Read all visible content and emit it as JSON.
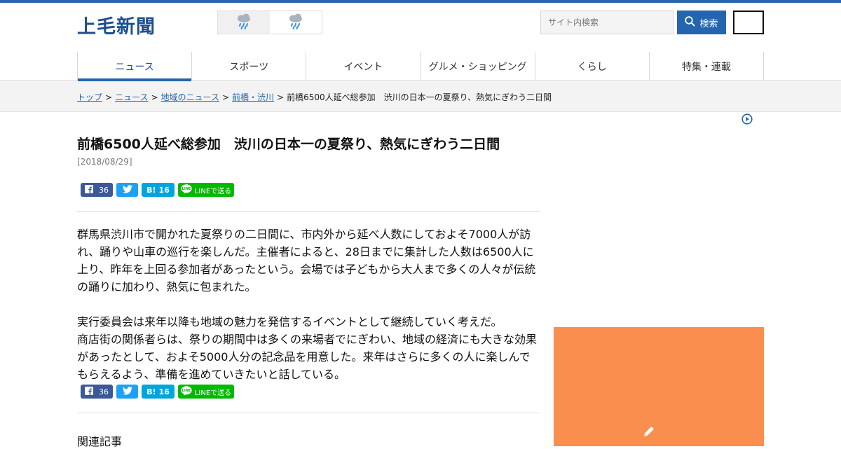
{
  "site": {
    "logo": "上毛新聞",
    "accent": "#2565ae"
  },
  "weather": [
    {
      "icon": "rain-cloud-icon"
    },
    {
      "icon": "rain-cloud-icon"
    }
  ],
  "search": {
    "placeholder": "サイト内検索",
    "button_label": "検索"
  },
  "nav": {
    "items": [
      {
        "label": "ニュース",
        "active": true
      },
      {
        "label": "スポーツ",
        "active": false
      },
      {
        "label": "イベント",
        "active": false
      },
      {
        "label": "グルメ・ショッピング",
        "active": false
      },
      {
        "label": "くらし",
        "active": false
      },
      {
        "label": "特集・連載",
        "active": false
      }
    ]
  },
  "breadcrumb": {
    "items": [
      "トップ",
      "ニュース",
      "地域のニュース",
      "前橋・渋川"
    ],
    "current": "前橋6500人延べ総参加　渋川の日本一の夏祭り、熱気にぎわう二日間"
  },
  "article": {
    "headline": "前橋6500人延べ総参加　渋川の日本一の夏祭り、熱気にぎわう二日間",
    "date": "[2018/08/29]",
    "paragraphs": [
      "群馬県渋川市で開かれた夏祭りの二日間に、市内外から延べ人数にしておよそ7000人が訪れ、踊りや山車の巡行を楽しんだ。主催者によると、28日までに集計した人数は6500人に上り、昨年を上回る参加者があったという。会場では子どもから大人まで多くの人々が伝統の踊りに加わり、熱気に包まれた。",
      "実行委員会は来年以降も地域の魅力を発信するイベントとして継続していく考えだ。",
      "商店街の関係者らは、祭りの期間中は多くの来場者でにぎわい、地域の経済にも大きな効果があったとして、およそ5000人分の記念品を用意した。来年はさらに多くの人に楽しんでもらえるよう、準備を進めていきたいと話している。"
    ],
    "related_heading": "関連記事"
  },
  "share": {
    "facebook_count": "36",
    "hatena_label": "B!",
    "hatena_count": "16",
    "line_label": "LINEで送る"
  },
  "side": {
    "ad_color": "#f98e4f"
  }
}
